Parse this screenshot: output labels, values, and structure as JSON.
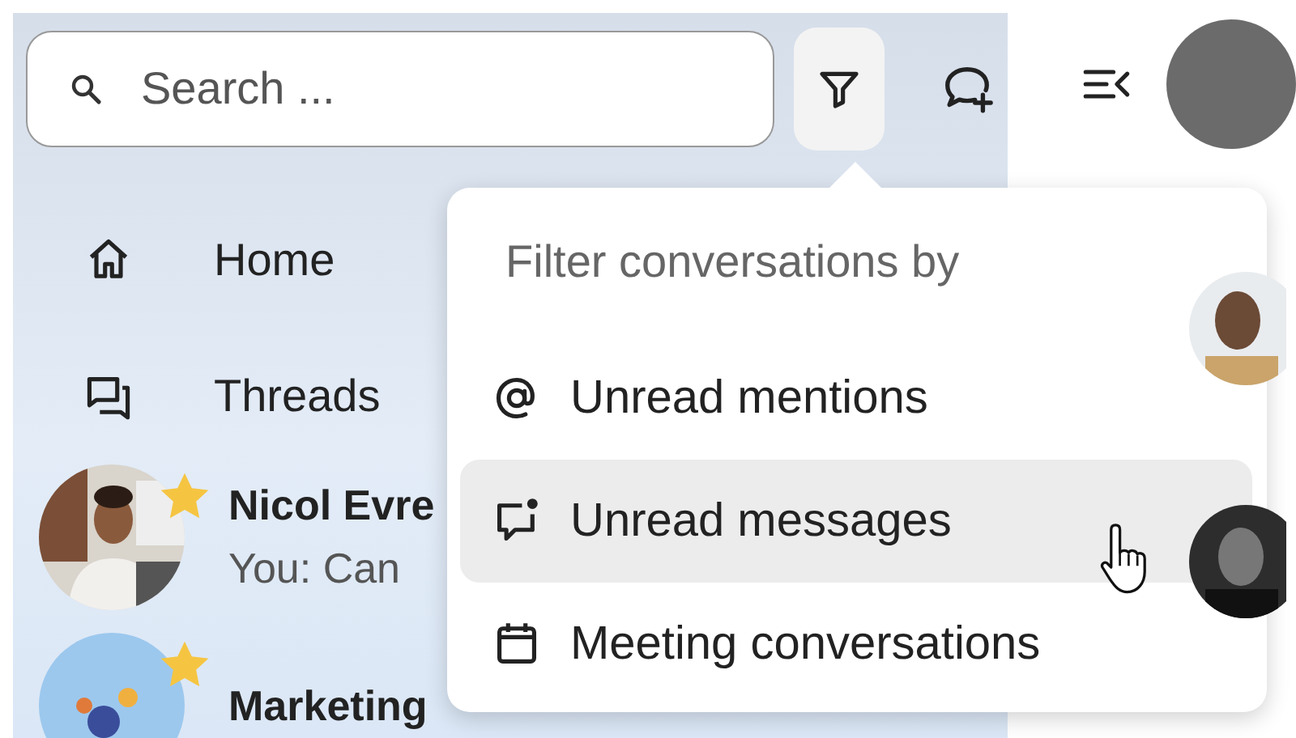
{
  "search": {
    "placeholder": "Search ..."
  },
  "toolbar": {
    "filter_active": true
  },
  "nav": [
    {
      "kind": "home",
      "label": "Home"
    },
    {
      "kind": "threads",
      "label": "Threads"
    }
  ],
  "conversations": [
    {
      "name": "Nicol Evre",
      "preview": "You: Can",
      "favorite": true,
      "kind": "picture"
    },
    {
      "name": "Marketing",
      "favorite": true,
      "kind": "picture"
    }
  ],
  "filter_menu": {
    "heading": "Filter conversations by",
    "items": [
      {
        "kind": "mention",
        "label": "Unread mentions",
        "highlighted": false
      },
      {
        "kind": "message",
        "label": "Unread messages",
        "highlighted": true
      },
      {
        "kind": "meeting",
        "label": "Meeting conversations",
        "highlighted": false
      }
    ]
  }
}
